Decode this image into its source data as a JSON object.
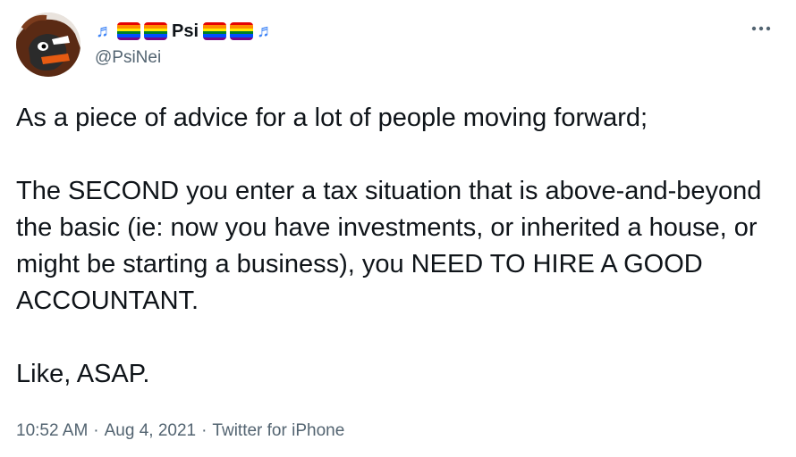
{
  "author": {
    "display_name": "Psi",
    "handle": "@PsiNei",
    "name_decorations": [
      "music-notes",
      "rainbow-flag",
      "rainbow-flag",
      "rainbow-flag",
      "rainbow-flag",
      "music-notes"
    ]
  },
  "tweet": {
    "line1": "As a piece of advice for a lot of people moving forward;",
    "para2": "The SECOND you enter a tax situation that is above-and-beyond the basic (ie: now you have investments, or inherited a house, or might be starting a business), you NEED TO HIRE A GOOD ACCOUNTANT.",
    "para3": "Like, ASAP."
  },
  "meta": {
    "time": "10:52 AM",
    "separator": "·",
    "date": "Aug 4, 2021",
    "source": "Twitter for iPhone"
  },
  "icons": {
    "more": "more-options-icon",
    "note": "music-notes-emoji",
    "flag": "rainbow-flag-emoji"
  },
  "colors": {
    "text": "#0f1419",
    "secondary": "#536471",
    "music_note": "#3b82f6",
    "rainbow": [
      "#e40303",
      "#ff8c00",
      "#ffed00",
      "#008026",
      "#004dff",
      "#750787"
    ]
  }
}
